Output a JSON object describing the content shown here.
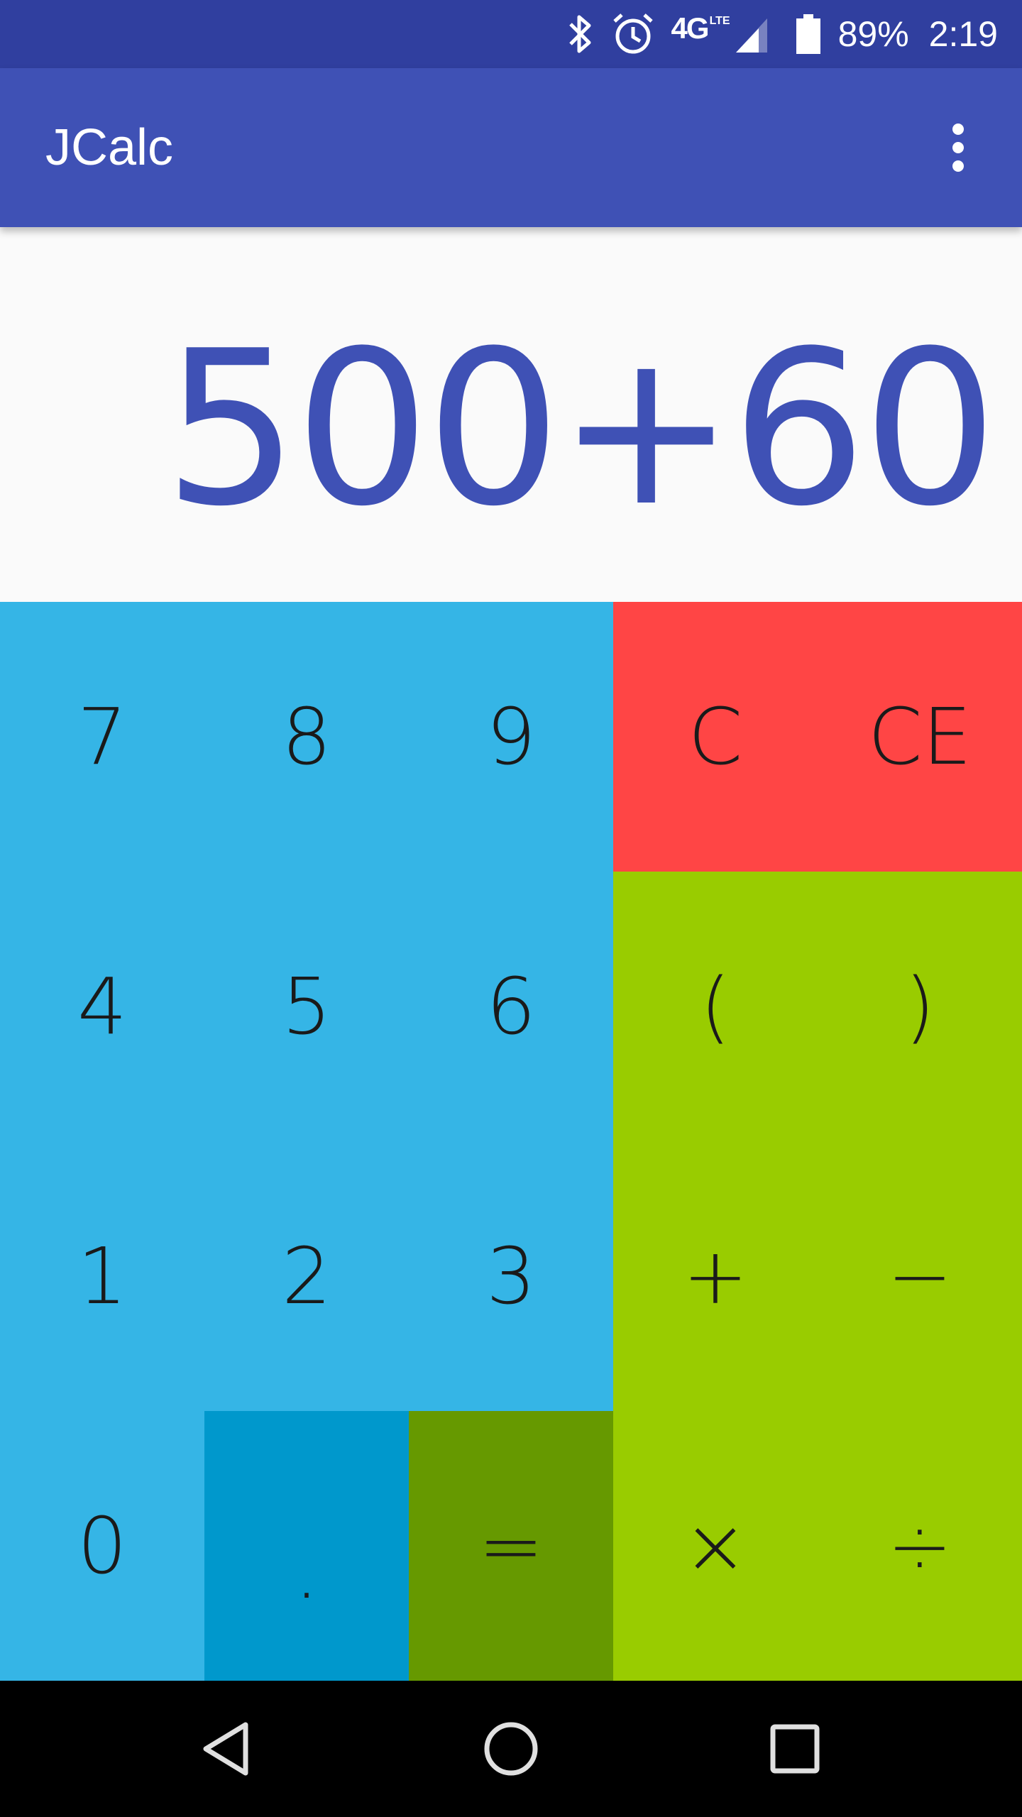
{
  "status_bar": {
    "network": "4G",
    "network_sub": "LTE",
    "battery_percent": "89%",
    "time": "2:19",
    "battery_level": 0.89,
    "icons": [
      "bluetooth-icon",
      "alarm-icon",
      "signal-icon",
      "battery-icon"
    ]
  },
  "app_bar": {
    "title": "JCalc",
    "overflow_icon": "more-vert-icon"
  },
  "display": {
    "expression": "500+60"
  },
  "keys": {
    "k7": "7",
    "k8": "8",
    "k9": "9",
    "clear": "C",
    "clear_entry": "CE",
    "k4": "4",
    "k5": "5",
    "k6": "6",
    "paren_open": "(",
    "paren_close": ")",
    "k1": "1",
    "k2": "2",
    "k3": "3",
    "plus": "+",
    "minus": "−",
    "k0": "0",
    "dot": ".",
    "equals": "=",
    "multiply": "×",
    "divide": "÷"
  },
  "colors": {
    "status_bar": "#303f9f",
    "app_bar": "#3f51b5",
    "display_text": "#3f51b5",
    "digits": "#35b5e6",
    "dot_key": "#0098cc",
    "clear_keys": "#ff4545",
    "operators": "#99cc00",
    "equals_key": "#669900"
  },
  "nav_bar": {
    "icons": [
      "back-icon",
      "home-icon",
      "recents-icon"
    ]
  }
}
